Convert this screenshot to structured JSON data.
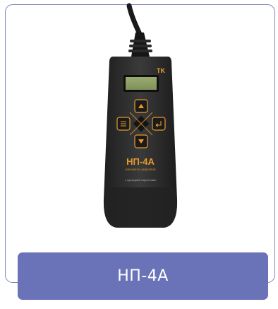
{
  "product": {
    "name": "НП-4А",
    "device_brand_mark": "TK",
    "device_model_text": "НП-4А",
    "device_subtitle": "манометр цифровой",
    "device_footer": "с функцией опрессовки"
  },
  "colors": {
    "card_border": "#7c86bd",
    "label_bg": "#6a73b8",
    "label_text": "#ffffff",
    "device_body": "#2b2b2b",
    "accent_orange": "#e69a2e",
    "lcd": "#8fa06a"
  }
}
